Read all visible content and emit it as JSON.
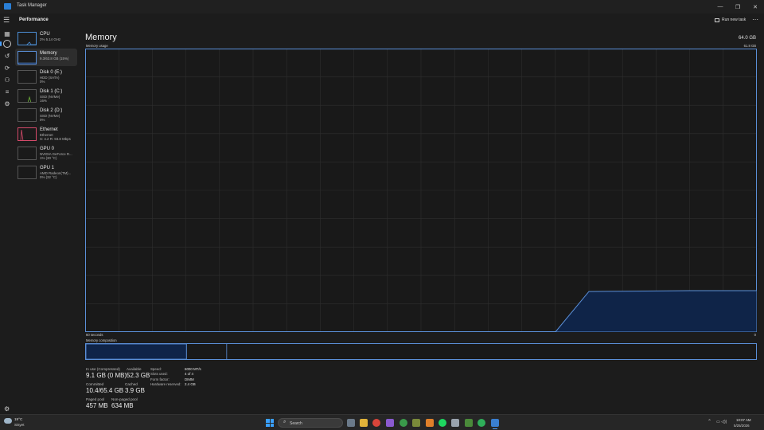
{
  "window": {
    "title": "Task Manager",
    "section": "Performance",
    "run_new_task": "Run new task",
    "more_icon": "ellipsis-icon",
    "controls": [
      "minimize",
      "maximize",
      "close"
    ]
  },
  "rail": {
    "icons": [
      "hamburger-icon",
      "processes-icon",
      "performance-icon",
      "app-history-icon",
      "startup-apps-icon",
      "users-icon",
      "details-icon",
      "services-icon",
      "settings-icon"
    ]
  },
  "devices": [
    {
      "name": "CPU",
      "sub1": "2% 5.14 GHz",
      "sub2": ""
    },
    {
      "name": "Memory",
      "sub1": "9.3/63.8 GB (15%)",
      "sub2": ""
    },
    {
      "name": "Disk 0 (E:)",
      "sub1": "HDD (SATA)",
      "sub2": "0%"
    },
    {
      "name": "Disk 1 (C:)",
      "sub1": "SSD (NVMe)",
      "sub2": "16%"
    },
    {
      "name": "Disk 2 (D:)",
      "sub1": "SSD (NVMe)",
      "sub2": "0%"
    },
    {
      "name": "Ethernet",
      "sub1": "Ethernet",
      "sub2": "S: 4.2 R: 93.8 Mbps"
    },
    {
      "name": "GPU 0",
      "sub1": "NVIDIA GeForce R...",
      "sub2": "1% (30 °C)"
    },
    {
      "name": "GPU 1",
      "sub1": "AMD Radeon(TM)...",
      "sub2": "0% (32 °C)"
    }
  ],
  "main": {
    "title": "Memory",
    "total": "64.0 GB",
    "usage_label": "Memory usage",
    "usage_max": "61.8 GB",
    "axis_left": "60 seconds",
    "axis_right": "0",
    "composition_label": "Memory composition"
  },
  "stats": {
    "in_use_label": "In use (Compressed)",
    "in_use": "9.1 GB (0 MB)",
    "available_label": "Available",
    "available": "52.3 GB",
    "committed_label": "Committed",
    "committed": "10.4/65.4 GB",
    "cached_label": "Cached",
    "cached": "3.9 GB",
    "paged_label": "Paged pool",
    "paged": "457 MB",
    "nonpaged_label": "Non-paged pool",
    "nonpaged": "634 MB"
  },
  "details": [
    {
      "label": "Speed:",
      "value": "6000 MT/s"
    },
    {
      "label": "Slots used:",
      "value": "4 of 4"
    },
    {
      "label": "Form factor:",
      "value": "DIMM"
    },
    {
      "label": "Hardware reserved:",
      "value": "2.4 GB"
    }
  ],
  "chart_data": {
    "type": "area",
    "x": [
      60,
      57,
      54,
      51,
      48,
      45,
      42,
      39,
      36,
      33,
      30,
      27,
      24,
      21,
      18,
      15,
      12,
      9,
      6,
      3,
      0
    ],
    "in_use_percent": [
      0,
      0,
      0,
      0,
      0,
      0,
      0,
      0,
      0,
      0,
      0,
      0,
      0,
      0,
      0,
      14.3,
      14.4,
      14.5,
      14.6,
      14.6,
      14.6
    ],
    "ylim": [
      0,
      100
    ],
    "grid": true
  },
  "composition": {
    "in_use_fraction": 0.15,
    "modified_fraction": 0.0,
    "standby_fraction": 0.06
  },
  "taskbar": {
    "weather_temp": "19°C",
    "weather_desc": "Sisyet",
    "search_placeholder": "Search",
    "time": "10:07 AM",
    "date": "5/25/2026",
    "tray": "⌃"
  },
  "colors": {
    "accent": "#4aa0ff",
    "memory_line": "#5b8fd8",
    "memory_fill": "#0f2448",
    "grid": "#2e2e2e",
    "ethernet": "#d44a6a",
    "cpu": "#4c8fd6",
    "disk1": "#6fb33a"
  }
}
